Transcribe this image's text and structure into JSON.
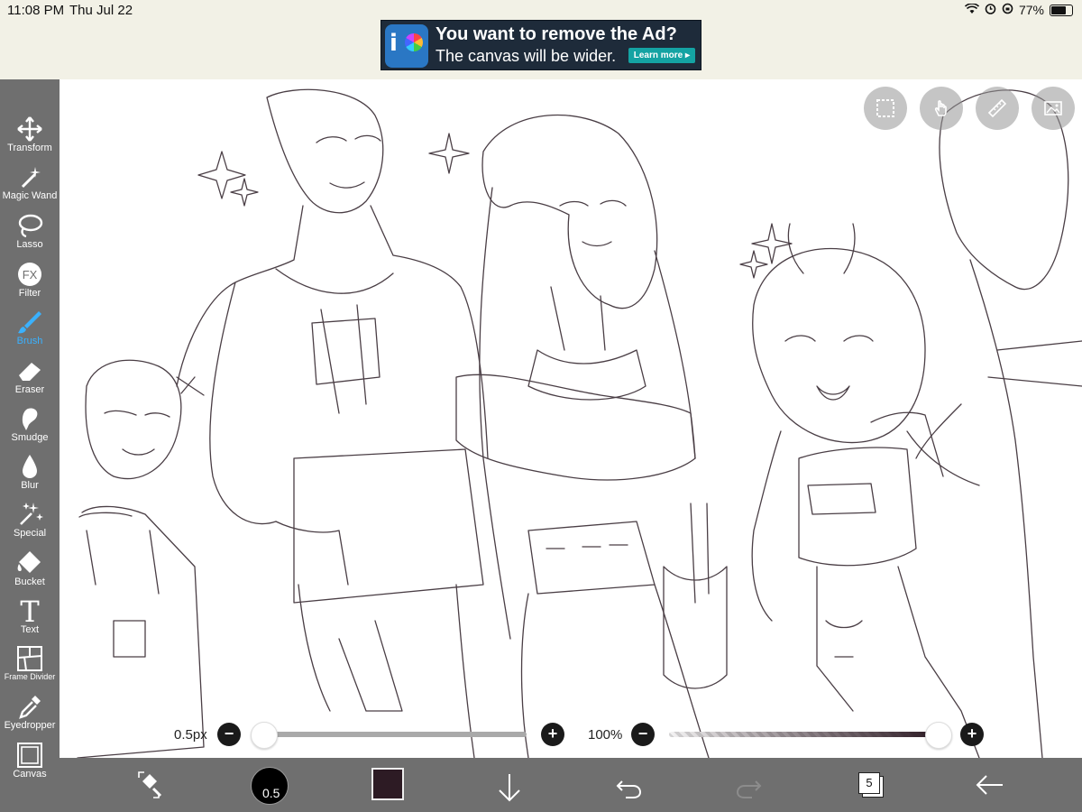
{
  "status": {
    "time": "11:08 PM",
    "date": "Thu Jul 22",
    "battery": "77%"
  },
  "ad": {
    "title": "You want to remove the Ad?",
    "subtitle": "The canvas will be wider.",
    "button": "Learn more ▸"
  },
  "toolbar": {
    "items": [
      {
        "label": "Transform",
        "icon": "transform-icon"
      },
      {
        "label": "Magic Wand",
        "icon": "magic-wand-icon"
      },
      {
        "label": "Lasso",
        "icon": "lasso-icon"
      },
      {
        "label": "Filter",
        "icon": "filter-icon"
      },
      {
        "label": "Brush",
        "icon": "brush-icon",
        "active": true
      },
      {
        "label": "Eraser",
        "icon": "eraser-icon"
      },
      {
        "label": "Smudge",
        "icon": "smudge-icon"
      },
      {
        "label": "Blur",
        "icon": "blur-icon"
      },
      {
        "label": "Special",
        "icon": "special-icon"
      },
      {
        "label": "Bucket",
        "icon": "bucket-icon"
      },
      {
        "label": "Text",
        "icon": "text-icon"
      },
      {
        "label": "Frame Divider",
        "icon": "frame-divider-icon"
      },
      {
        "label": "Eyedropper",
        "icon": "eyedropper-icon"
      },
      {
        "label": "Canvas",
        "icon": "canvas-icon"
      }
    ],
    "filter_glyph": "FX",
    "text_glyph": "T"
  },
  "sliders": {
    "size_label": "0.5px",
    "size_value_fraction": 0.0,
    "opacity_label": "100%",
    "opacity_value_fraction": 1.0,
    "minus": "−",
    "plus": "+"
  },
  "bottombar": {
    "brush_size": "0.5",
    "color": "#2d1b24",
    "layer_count": "5"
  },
  "colors": {
    "toolbar_bg": "#6f6f6f",
    "accent": "#3ab1ff",
    "ad_bg": "#1e2b3a",
    "ad_button": "#14a3a3"
  }
}
